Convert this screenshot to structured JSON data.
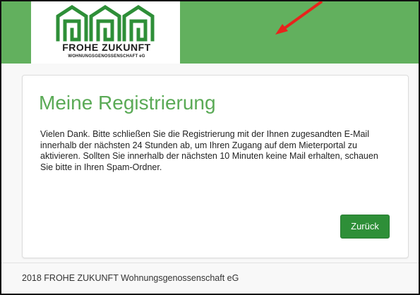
{
  "header": {
    "background_color": "#62b05e",
    "logo": {
      "name": "FROHE ZUKUNFT",
      "subtitle": "WOHNUNGSGENOSSENSCHAFT eG",
      "brand_color": "#2e8f38"
    }
  },
  "annotation": {
    "icon": "red-arrow-icon",
    "color": "#e8231c"
  },
  "card": {
    "title": "Meine Registrierung",
    "message": "Vielen Dank. Bitte schließen Sie die Registrierung mit der Ihnen zugesandten E-Mail innerhalb der nächsten 24 Stunden ab, um Ihren Zugang auf dem Mieterportal zu aktivieren. Sollten Sie innerhalb der nächsten 10 Minuten keine Mail erhalten, schauen Sie bitte in Ihren Spam-Ordner.",
    "back_button_label": "Zurück",
    "title_color": "#5aaa56",
    "button_color": "#2e8f38"
  },
  "footer": {
    "text": "2018 FROHE ZUKUNFT Wohnungsgenossenschaft eG"
  }
}
